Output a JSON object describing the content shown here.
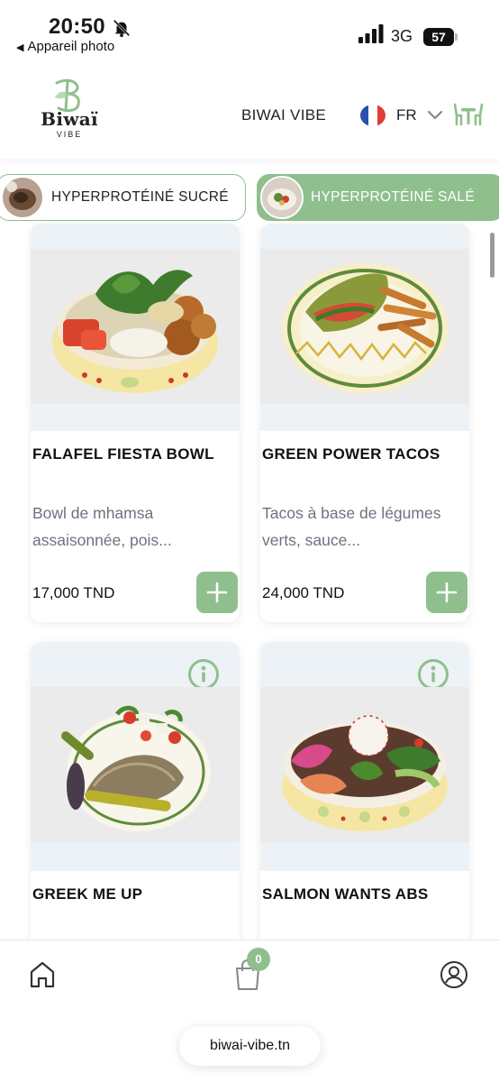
{
  "status_bar": {
    "time": "20:50",
    "back_app": "Appareil photo",
    "network": "3G",
    "battery": "57"
  },
  "header": {
    "logo_name": "Biwaï",
    "logo_sub": "VIBE",
    "nav_title": "BIWAI VIBE",
    "language": "FR"
  },
  "categories": [
    {
      "label": "HYPERPROTÉINÉ SUCRÉ",
      "active": false
    },
    {
      "label": "HYPERPROTÉINÉ SALÉ",
      "active": true
    }
  ],
  "products": [
    {
      "name": "FALAFEL FIESTA BOWL",
      "description": "Bowl de mhamsa assaisonnée, pois...",
      "price": "17,000 TND"
    },
    {
      "name": "GREEN POWER TACOS",
      "description": "Tacos à base de légumes verts, sauce...",
      "price": "24,000 TND"
    },
    {
      "name": "GREEK ME UP"
    },
    {
      "name": "SALMON WANTS ABS"
    }
  ],
  "bottom_nav": {
    "cart_count": "0",
    "url": "biwai-vibe.tn"
  },
  "colors": {
    "accent": "#8fbf8d",
    "image_background": "#edf2f6",
    "description_text": "#6b7380"
  },
  "icons": [
    "bell-slash-icon",
    "signal-icon",
    "battery-icon",
    "france-flag-icon",
    "chevron-down-icon",
    "table-chairs-icon",
    "plus-icon",
    "info-icon",
    "home-icon",
    "shopping-bag-icon",
    "user-icon"
  ]
}
